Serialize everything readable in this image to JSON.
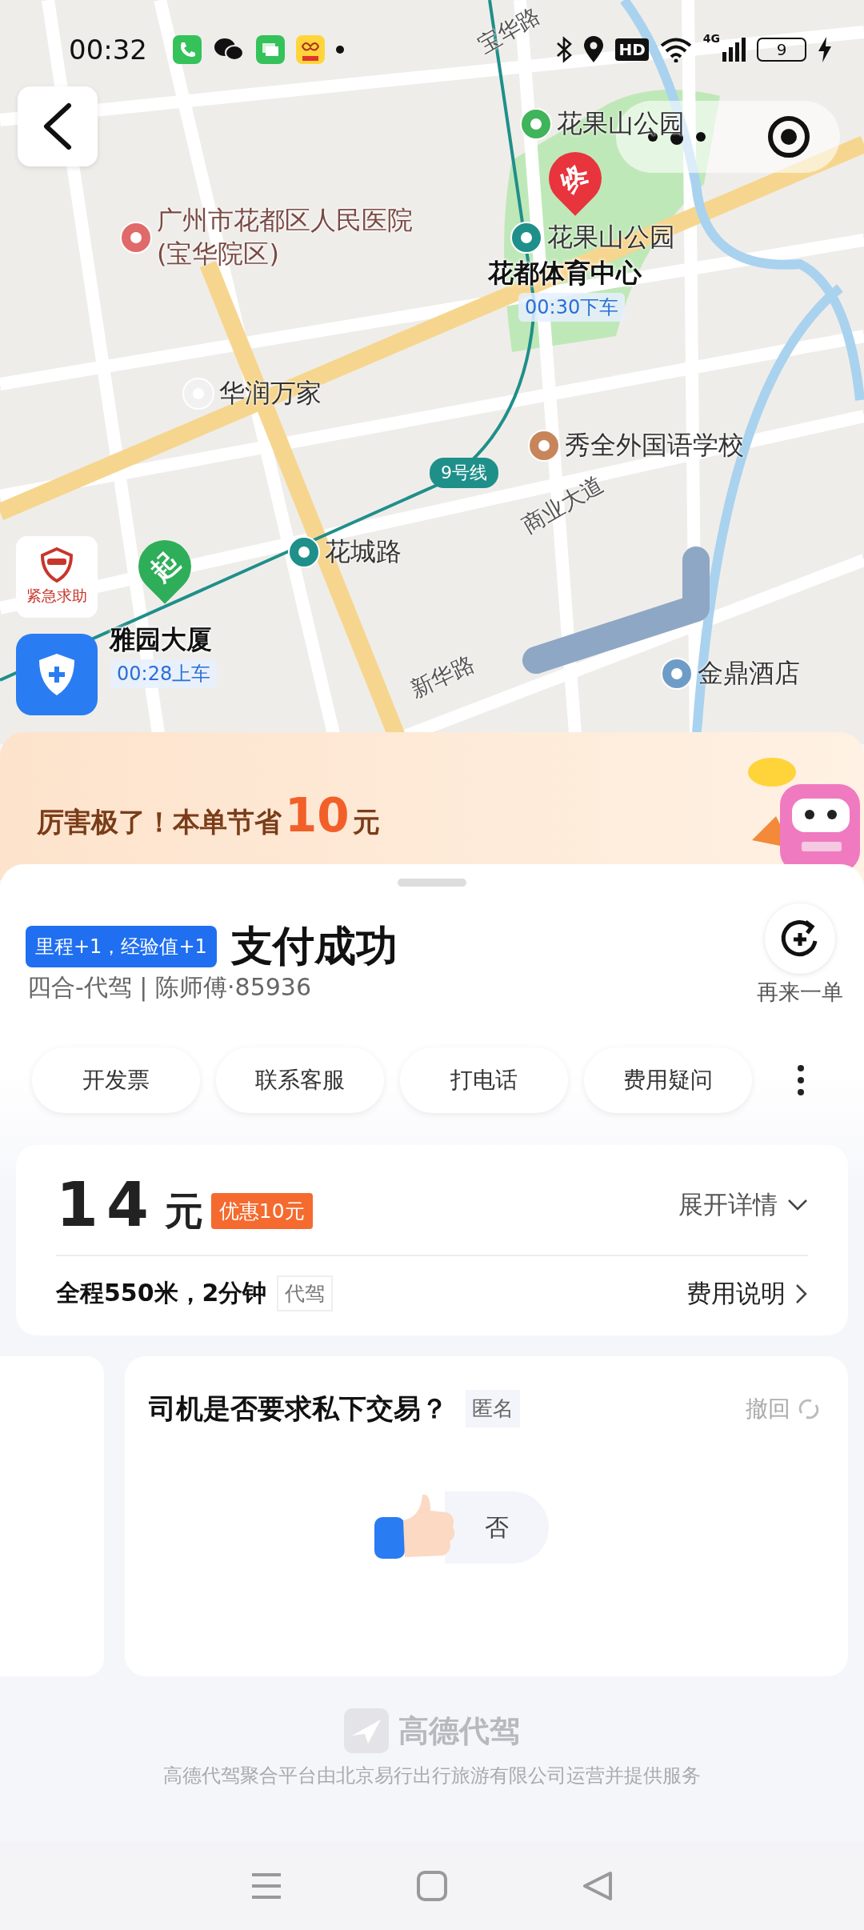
{
  "status_bar": {
    "time": "00:32",
    "network_badge": "HD",
    "network_type": "4G",
    "battery": "9"
  },
  "map": {
    "labels": [
      {
        "kind": "road",
        "text": "宝华路"
      },
      {
        "kind": "park",
        "text": "花果山公园"
      },
      {
        "kind": "hospital",
        "text": "广州市花都区人民医院(宝华院区)"
      },
      {
        "kind": "metro",
        "text": "花果山公园"
      },
      {
        "kind": "place",
        "text": "华润万家"
      },
      {
        "kind": "school",
        "text": "秀全外国语学校"
      },
      {
        "kind": "line",
        "text": "9号线"
      },
      {
        "kind": "road",
        "text": "商业大道"
      },
      {
        "kind": "metro",
        "text": "花城路"
      },
      {
        "kind": "road",
        "text": "新华路"
      },
      {
        "kind": "hotel",
        "text": "金鼎酒店"
      }
    ],
    "end": {
      "pin": "终",
      "name": "花都体育中心",
      "time": "00:30下车"
    },
    "start": {
      "pin": "起",
      "name": "雅园大厦",
      "time": "00:28上车"
    },
    "sos_label": "紧急求助"
  },
  "savings": {
    "prefix": "厉害极了！本单节省",
    "amount": "10",
    "unit": "元"
  },
  "order": {
    "badge": "里程+1，经验值+1",
    "title": "支付成功",
    "subtitle": "四合-代驾 | 陈师傅·85936",
    "reorder": "再来一单"
  },
  "actions": [
    "开发票",
    "联系客服",
    "打电话",
    "费用疑问"
  ],
  "fare": {
    "amount": "14",
    "unit": "元",
    "discount": "优惠10元",
    "expand": "展开详情",
    "summary": "全程550米，2分钟",
    "service_tag": "代驾",
    "explain": "费用说明"
  },
  "survey": {
    "question": "司机是否要求私下交易？",
    "tag": "匿名",
    "undo": "撤回",
    "answer": "否"
  },
  "footer": {
    "brand": "高德代驾",
    "note": "高德代驾聚合平台由北京易行出行旅游有限公司运营并提供服务"
  }
}
